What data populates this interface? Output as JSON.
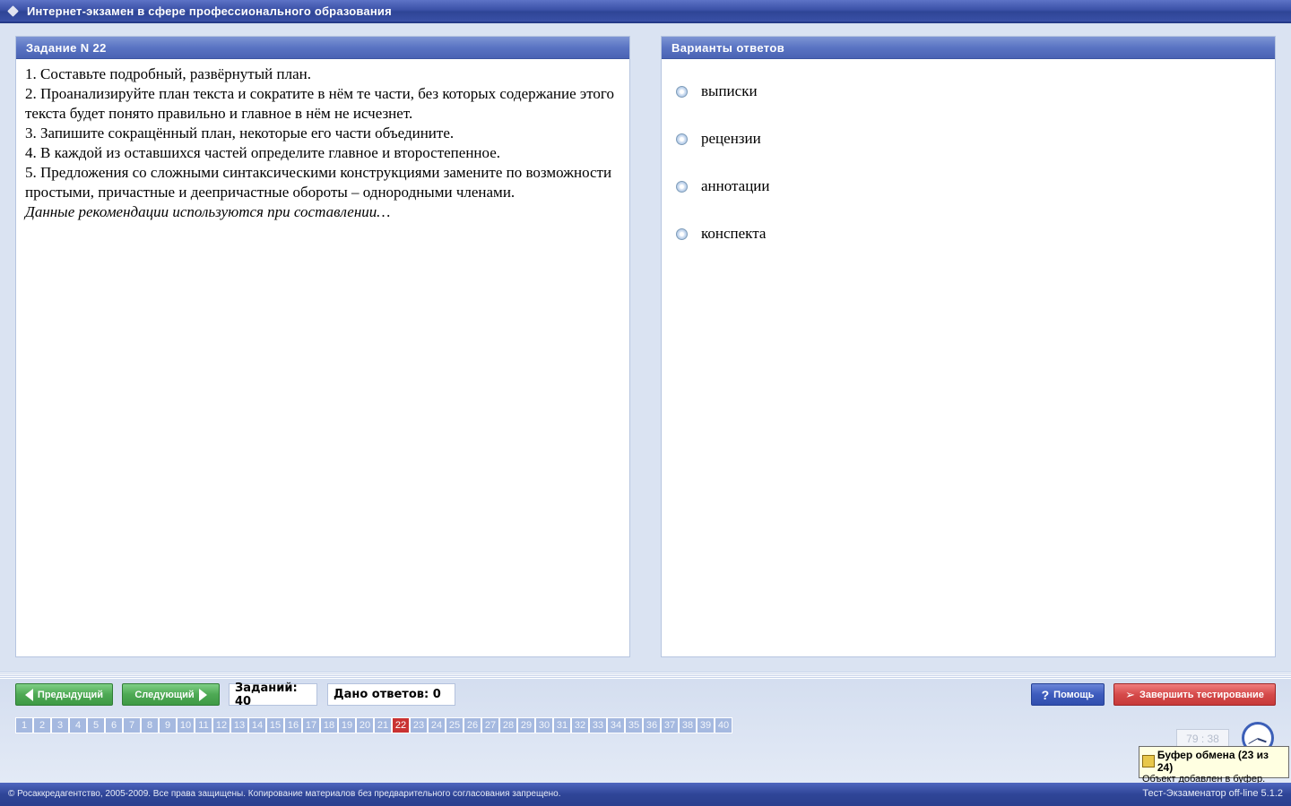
{
  "window": {
    "title": "Интернет-экзамен в сфере профессионального образования"
  },
  "task": {
    "header": "Задание N 22",
    "lines": [
      "1. Составьте подробный, развёрнутый план.",
      "2. Проанализируйте план текста и сократите в нём те части, без которых содержание этого текста будет понято правильно и главное в нём не исчезнет.",
      "3. Запишите сокращённый план, некоторые его части объедините.",
      "4. В каждой из оставшихся частей определите главное и второстепенное.",
      "5. Предложения со сложными синтаксическими конструкциями замените по возможности простыми, причастные и деепричастные обороты – однородными членами."
    ],
    "prompt": "Данные рекомендации используются при составлении…"
  },
  "answers": {
    "header": "Варианты ответов",
    "options": [
      "выписки",
      "рецензии",
      "аннотации",
      "конспекта"
    ]
  },
  "nav": {
    "prev_label": "Предыдущий",
    "next_label": "Следующий",
    "tasks_count": "Заданий: 40",
    "answers_given": "Дано ответов: 0",
    "help_label": "Помощь",
    "finish_label": "Завершить тестирование",
    "current": "22",
    "numbers": [
      "1",
      "2",
      "3",
      "4",
      "5",
      "6",
      "7",
      "8",
      "9",
      "10",
      "11",
      "12",
      "13",
      "14",
      "15",
      "16",
      "17",
      "18",
      "19",
      "20",
      "21",
      "22",
      "23",
      "24",
      "25",
      "26",
      "27",
      "28",
      "29",
      "30",
      "31",
      "32",
      "33",
      "34",
      "35",
      "36",
      "37",
      "38",
      "39",
      "40"
    ]
  },
  "timer": {
    "value": "79 : 38"
  },
  "tooltip": {
    "title": "Буфер обмена (23 из 24)",
    "message": "Объект добавлен в буфер."
  },
  "footer": {
    "copyright": "© Росаккредагентство, 2005-2009. Все права защищены. Копирование материалов без предварительного согласования запрещено.",
    "version": "Тест-Экзаменатор off-line 5.1.2"
  },
  "colors": {
    "titlebar": "#3c52a8",
    "panel_header": "#5a74c3",
    "active_number": "#c93232",
    "inactive_number": "#a5b9e0",
    "green_button": "#4ea954",
    "blue_button": "#3d5bbd",
    "red_button": "#d54a4a"
  },
  "icons": {
    "prev": "arrow-left-icon",
    "next": "arrow-right-icon",
    "help": "question-icon",
    "finish": "runner-icon",
    "clock": "clock-icon",
    "clipboard": "clipboard-icon"
  }
}
